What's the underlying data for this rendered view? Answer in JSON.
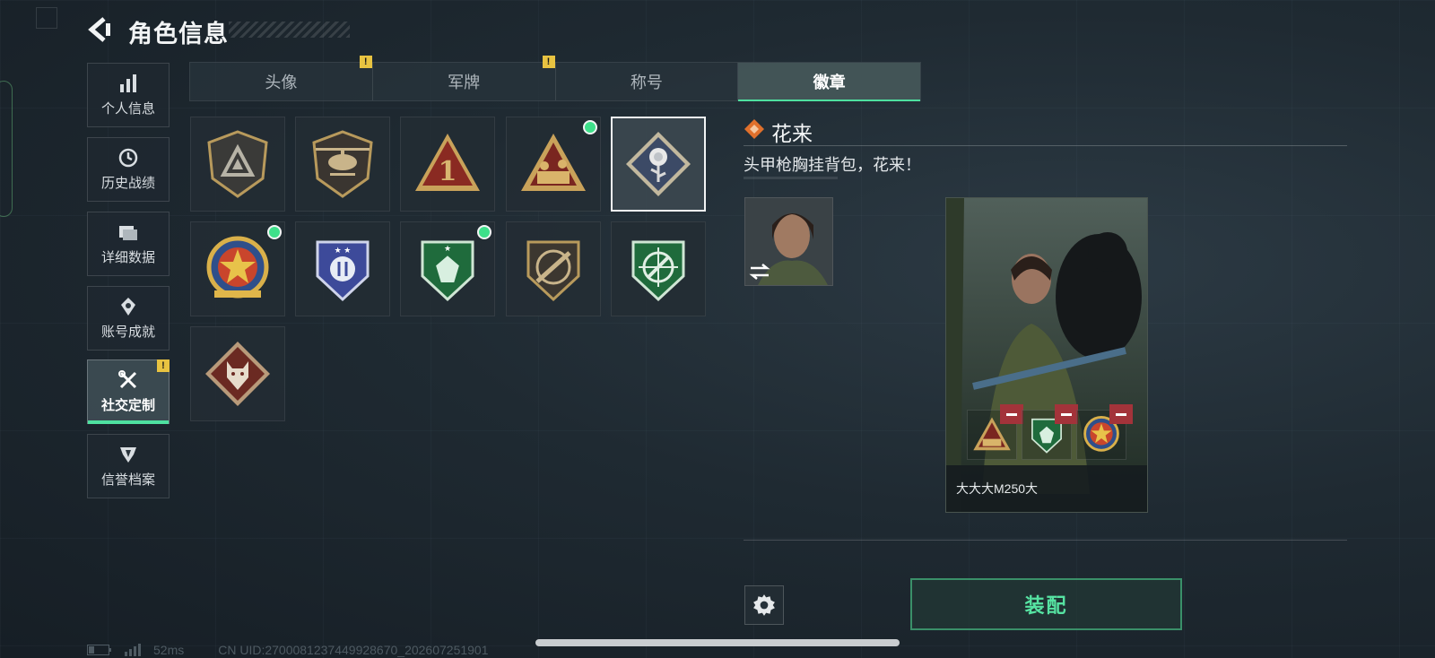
{
  "header": {
    "title": "角色信息"
  },
  "sidebar": {
    "items": [
      {
        "label": "个人信息",
        "icon": "bar-chart-icon"
      },
      {
        "label": "历史战绩",
        "icon": "history-icon"
      },
      {
        "label": "详细数据",
        "icon": "folder-icon"
      },
      {
        "label": "账号成就",
        "icon": "achievement-icon"
      },
      {
        "label": "社交定制",
        "icon": "tools-icon",
        "active": true,
        "badge": "!"
      },
      {
        "label": "信誉档案",
        "icon": "reputation-icon"
      }
    ]
  },
  "tabs": [
    {
      "label": "头像",
      "badge": "!"
    },
    {
      "label": "军牌",
      "badge": "!"
    },
    {
      "label": "称号"
    },
    {
      "label": "徽章",
      "active": true
    }
  ],
  "badges": [
    {
      "name": "triangle-shield-badge",
      "selected": false,
      "new": false
    },
    {
      "name": "helicopter-badge",
      "selected": false,
      "new": false
    },
    {
      "name": "number-one-badge",
      "selected": false,
      "new": false
    },
    {
      "name": "soldiers-badge",
      "selected": false,
      "new": true
    },
    {
      "name": "rose-badge",
      "selected": true,
      "new": false
    },
    {
      "name": "star-medal-badge",
      "selected": false,
      "new": true
    },
    {
      "name": "blue-wings-badge",
      "selected": false,
      "new": false
    },
    {
      "name": "green-gem-badge",
      "selected": false,
      "new": true
    },
    {
      "name": "rifle-badge",
      "selected": false,
      "new": false
    },
    {
      "name": "green-crosshair-badge",
      "selected": false,
      "new": false
    },
    {
      "name": "wolf-badge",
      "selected": false,
      "new": false
    }
  ],
  "detail": {
    "name": "花来",
    "description": "头甲枪胸挂背包，花来！"
  },
  "card": {
    "player_name": "大大大M250大",
    "equipped": [
      "soldiers-badge",
      "green-gem-badge",
      "star-medal-badge"
    ]
  },
  "actions": {
    "equip_label": "装配"
  },
  "status": {
    "ping": "52ms",
    "uid": "CN UID:2700081237449928670_202607251901"
  },
  "colors": {
    "accent": "#4ee0a0",
    "warning": "#e8c341",
    "remove": "#a3333a"
  }
}
